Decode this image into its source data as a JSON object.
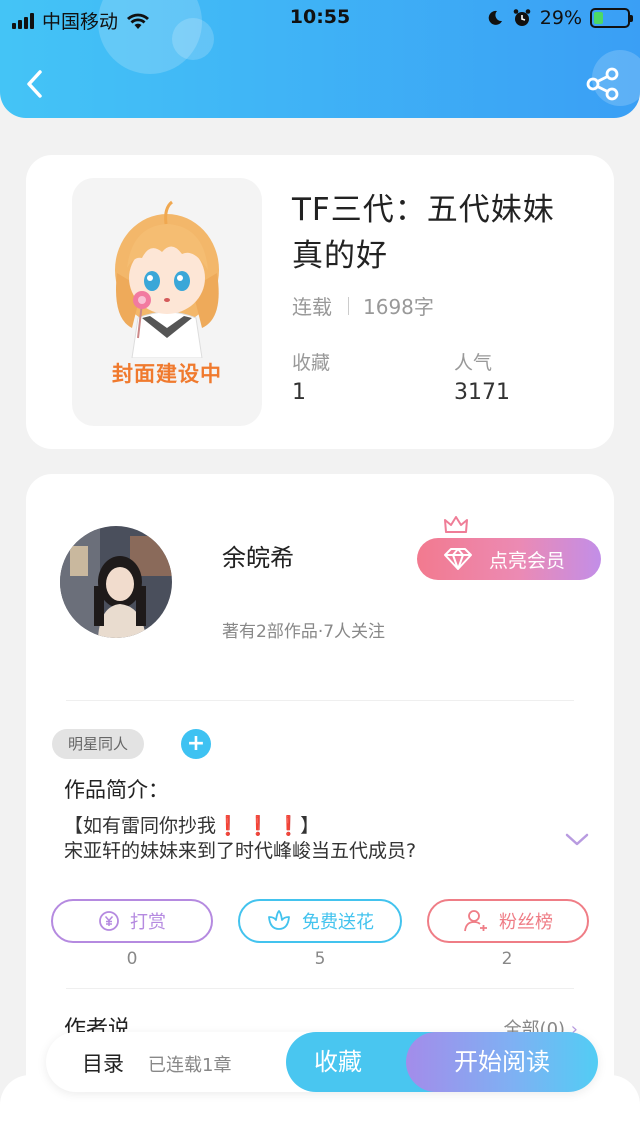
{
  "status_bar": {
    "carrier": "中国移动",
    "time": "10:55",
    "battery": "29%",
    "battery_level": 0.29
  },
  "header": {
    "back_icon": "chevron-left-icon",
    "share_icon": "share-icon"
  },
  "book": {
    "cover_caption": "封面建设中",
    "title": "TF三代：五代妹妹真的好",
    "status": "连载",
    "word_count": "1698字",
    "favorites_label": "收藏",
    "favorites_value": "1",
    "popularity_label": "人气",
    "popularity_value": "3171"
  },
  "author": {
    "name": "余皖希",
    "meta": "著有2部作品·7人关注",
    "vip_button": "点亮会员"
  },
  "tags": [
    "明星同人"
  ],
  "intro": {
    "label": "作品简介：",
    "line1_pre": "【如有雷同你抄我",
    "line1_marks": "❗ ❗ ❗",
    "line1_post": "】",
    "line2": "宋亚轩的妹妹来到了时代峰峻当五代成员?"
  },
  "actions": [
    {
      "label": "打赏",
      "count": "0",
      "icon": "yuan-coin-icon",
      "color": "#b58ae0"
    },
    {
      "label": "免费送花",
      "count": "5",
      "icon": "flower-icon",
      "color": "#43c3ee"
    },
    {
      "label": "粉丝榜",
      "count": "2",
      "icon": "user-rank-icon",
      "color": "#ef7d86"
    }
  ],
  "author_says": {
    "label": "作者说",
    "view_all": "全部(0)"
  },
  "bottom_bar": {
    "toc": "目录",
    "toc_sub": "已连载1章",
    "favorite": "收藏",
    "start_reading": "开始阅读"
  }
}
